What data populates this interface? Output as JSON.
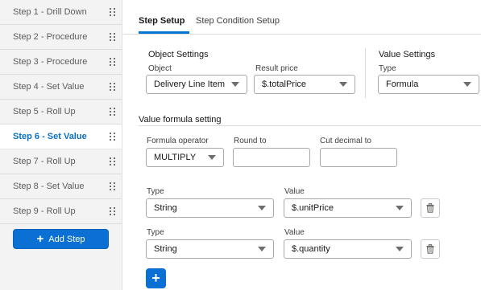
{
  "sidebar": {
    "steps": [
      {
        "label": "Step 1 - Drill Down"
      },
      {
        "label": "Step 2 - Procedure"
      },
      {
        "label": "Step 3 - Procedure"
      },
      {
        "label": "Step 4 - Set Value"
      },
      {
        "label": "Step 5 - Roll Up"
      },
      {
        "label": "Step 6 - Set Value",
        "active": true
      },
      {
        "label": "Step 7 - Roll Up"
      },
      {
        "label": "Step 8 - Set Value"
      },
      {
        "label": "Step 9 - Roll Up"
      }
    ],
    "add_step_label": "Add Step",
    "drag_icon": "drag-handle-icon"
  },
  "tabs": [
    {
      "label": "Step Setup",
      "active": true
    },
    {
      "label": "Step Condition Setup",
      "active": false
    }
  ],
  "object_settings": {
    "title": "Object Settings",
    "object_label": "Object",
    "object_value": "Delivery Line Item",
    "result_label": "Result price",
    "result_value": "$.totalPrice"
  },
  "value_settings": {
    "title": "Value Settings",
    "type_label": "Type",
    "type_value": "Formula"
  },
  "formula": {
    "title": "Value formula setting",
    "operator_label": "Formula operator",
    "operator_value": "MULTIPLY",
    "round_label": "Round to",
    "round_value": "",
    "cut_label": "Cut decimal to",
    "cut_value": "",
    "rows": [
      {
        "type_label": "Type",
        "type_value": "String",
        "value_label": "Value",
        "value_value": "$.unitPrice"
      },
      {
        "type_label": "Type",
        "type_value": "String",
        "value_label": "Value",
        "value_value": "$.quantity"
      }
    ],
    "delete_icon": "trash-icon",
    "add_icon": "plus-icon"
  },
  "colors": {
    "accent": "#0176d3",
    "button": "#0b70d4",
    "sidebar_bg": "#f3f3f3",
    "active_step_text": "#0b6fc4"
  }
}
